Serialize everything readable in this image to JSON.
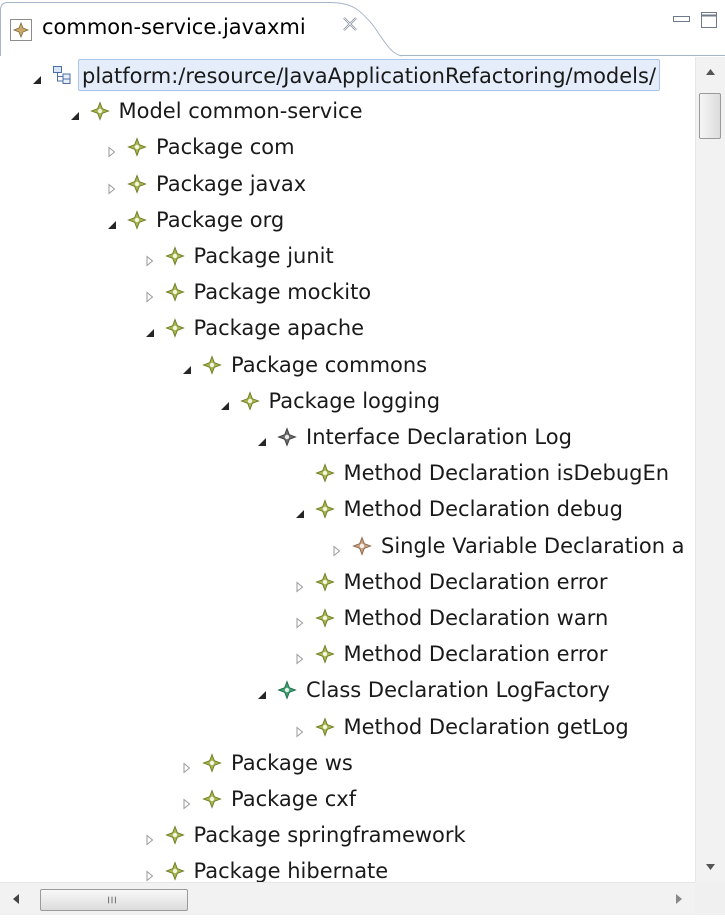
{
  "editor": {
    "tab_title": "common-service.javaxmi",
    "tab_icon": "model-file-icon",
    "close_icon": "close-x-icon",
    "minimize_icon": "minimize-icon",
    "maximize_icon": "maximize-icon"
  },
  "tree": {
    "nodes": [
      {
        "label": "platform:/resource/JavaApplicationRefactoring/models/",
        "level": 0,
        "toggle": "expanded",
        "icon": "resource-set-icon",
        "selected": true
      },
      {
        "label": "Model common-service",
        "level": 1,
        "toggle": "expanded",
        "icon": "model-element-icon"
      },
      {
        "label": "Package com",
        "level": 2,
        "toggle": "collapsed",
        "icon": "package-icon"
      },
      {
        "label": "Package javax",
        "level": 2,
        "toggle": "collapsed",
        "icon": "package-icon"
      },
      {
        "label": "Package org",
        "level": 2,
        "toggle": "expanded",
        "icon": "package-icon"
      },
      {
        "label": "Package junit",
        "level": 3,
        "toggle": "collapsed",
        "icon": "package-icon"
      },
      {
        "label": "Package mockito",
        "level": 3,
        "toggle": "collapsed",
        "icon": "package-icon"
      },
      {
        "label": "Package apache",
        "level": 3,
        "toggle": "expanded",
        "icon": "package-icon"
      },
      {
        "label": "Package commons",
        "level": 4,
        "toggle": "expanded",
        "icon": "package-icon"
      },
      {
        "label": "Package logging",
        "level": 5,
        "toggle": "expanded",
        "icon": "package-icon"
      },
      {
        "label": "Interface Declaration Log",
        "level": 6,
        "toggle": "expanded",
        "icon": "interface-icon"
      },
      {
        "label": "Method Declaration isDebugEn",
        "level": 7,
        "toggle": "none",
        "icon": "method-icon"
      },
      {
        "label": "Method Declaration debug",
        "level": 7,
        "toggle": "expanded",
        "icon": "method-icon"
      },
      {
        "label": "Single Variable Declaration a",
        "level": 8,
        "toggle": "collapsed",
        "icon": "variable-icon"
      },
      {
        "label": "Method Declaration error",
        "level": 7,
        "toggle": "collapsed",
        "icon": "method-icon"
      },
      {
        "label": "Method Declaration warn",
        "level": 7,
        "toggle": "collapsed",
        "icon": "method-icon"
      },
      {
        "label": "Method Declaration error",
        "level": 7,
        "toggle": "collapsed",
        "icon": "method-icon"
      },
      {
        "label": "Class Declaration LogFactory",
        "level": 6,
        "toggle": "expanded",
        "icon": "class-icon"
      },
      {
        "label": "Method Declaration getLog",
        "level": 7,
        "toggle": "collapsed",
        "icon": "method-icon"
      },
      {
        "label": "Package ws",
        "level": 4,
        "toggle": "collapsed",
        "icon": "package-icon"
      },
      {
        "label": "Package cxf",
        "level": 4,
        "toggle": "collapsed",
        "icon": "package-icon"
      },
      {
        "label": "Package springframework",
        "level": 3,
        "toggle": "collapsed",
        "icon": "package-icon"
      },
      {
        "label": "Package hibernate",
        "level": 3,
        "toggle": "collapsed",
        "icon": "package-icon"
      }
    ]
  },
  "scrollbars": {
    "vertical": {
      "up_icon": "scroll-up-arrow-icon",
      "down_icon": "scroll-down-arrow-icon"
    },
    "horizontal": {
      "left_icon": "scroll-left-arrow-icon",
      "right_icon": "scroll-right-arrow-icon"
    }
  },
  "colors": {
    "element_icon": "#a8b44c",
    "interface_icon": "#6b6b6b",
    "class_icon": "#3aa06e",
    "variable_icon": "#c9a183",
    "selection_bg": "#e4edf9",
    "selection_border": "#aac5e9"
  }
}
